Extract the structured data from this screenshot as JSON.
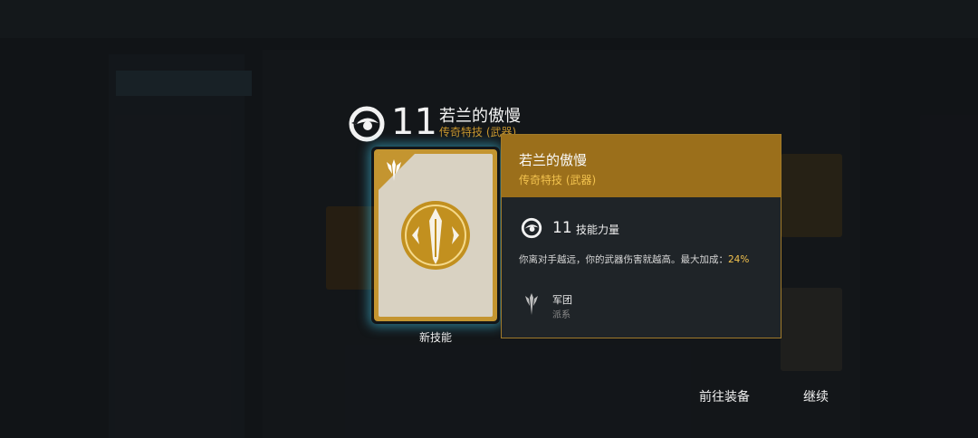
{
  "skill": {
    "level": "11",
    "name": "若兰的傲慢",
    "subtype": "传奇特技 (武器)"
  },
  "card": {
    "caption": "新技能"
  },
  "tooltip": {
    "title": "若兰的傲慢",
    "subtitle": "传奇特技 (武器)",
    "power_level": "11",
    "power_label": "技能力量",
    "description_prefix": "你离对手越远，你的武器伤害就越高。最大加成：",
    "description_value": "24%",
    "faction_name": "军团",
    "faction_label": "派系"
  },
  "actions": {
    "go_equip": "前往装备",
    "continue": "继续"
  },
  "colors": {
    "gold": "#c49530",
    "highlight": "#f2c24e",
    "tooltip_header": "#9b6f1b",
    "glow": "#40c4e6"
  },
  "icons": {
    "skill_power": "skill-power-icon",
    "card_corner": "legion-emblem-icon",
    "card_emblem": "blade-emblem-icon",
    "faction": "legion-faction-icon"
  }
}
